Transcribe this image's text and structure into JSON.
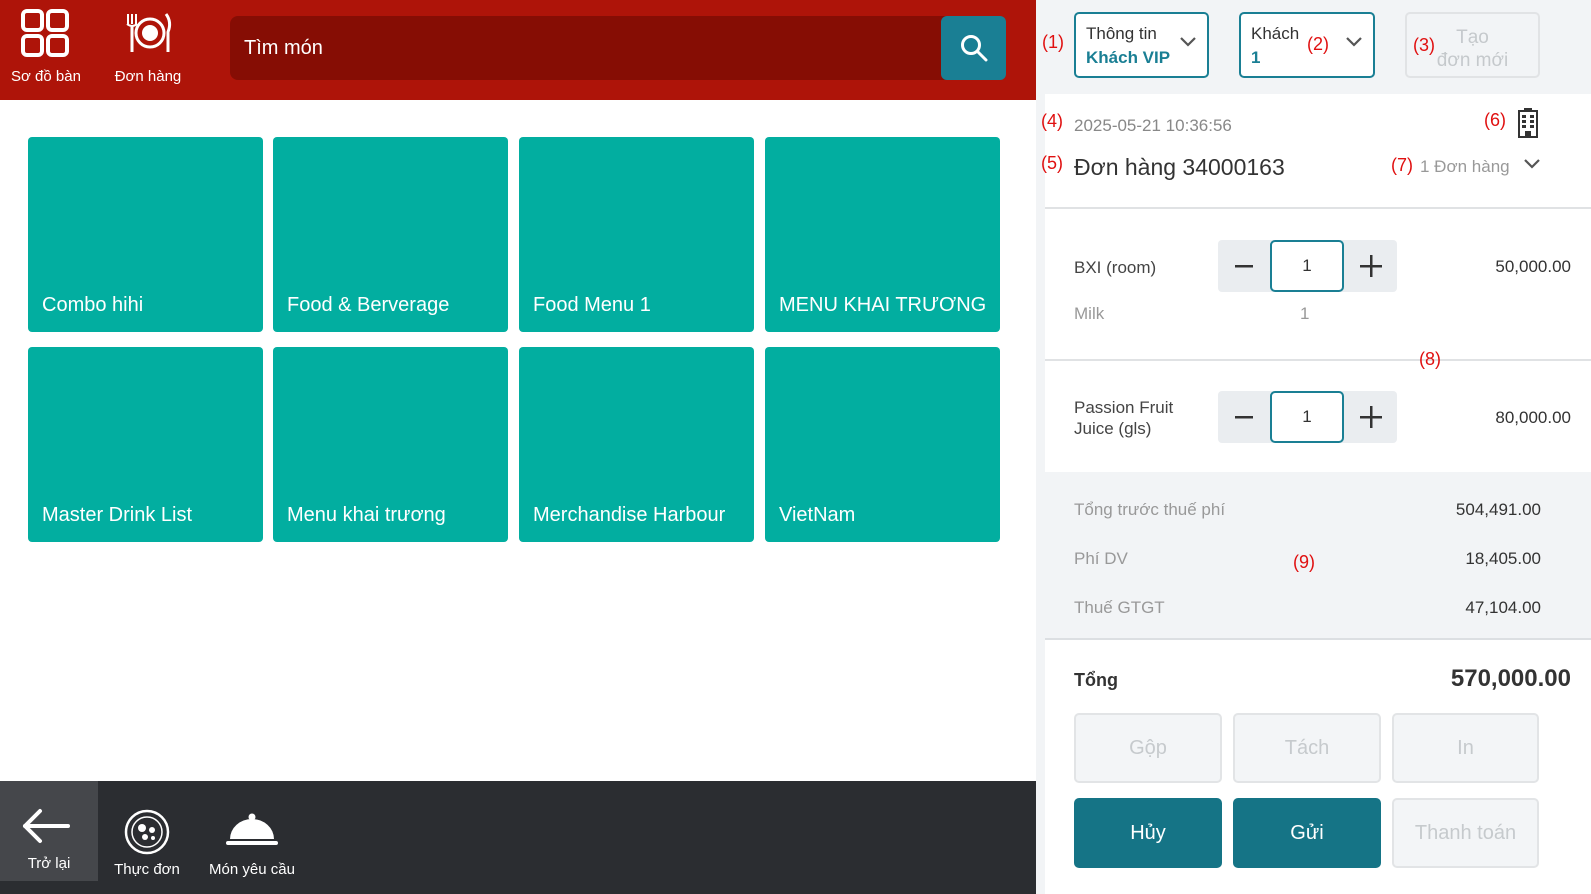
{
  "topbar": {
    "tables_label": "Sơ đồ bàn",
    "orders_label": "Đơn hàng",
    "search_placeholder": "Tìm món"
  },
  "menu_categories": [
    "Combo hihi",
    "Food & Berverage",
    "Food Menu 1",
    "MENU KHAI TRƯƠNG",
    "Master Drink List",
    "Menu khai trương",
    "Merchandise Harbour",
    "VietNam"
  ],
  "bottombar": {
    "back_label": "Trở lại",
    "menu_label": "Thực đơn",
    "request_label": "Món yêu cầu"
  },
  "order_panel": {
    "guest_label": "Thông tin",
    "guest_value": "Khách VIP",
    "people_label": "Khách",
    "people_value": "1",
    "new_order_line1": "Tạo",
    "new_order_line2": "đơn mới",
    "timestamp": "2025-05-21 10:36:56",
    "order_title": "Đơn hàng 34000163",
    "order_count": "1 Đơn hàng",
    "annotations": [
      "(1)",
      "(2)",
      "(3)",
      "(4)",
      "(5)",
      "(6)",
      "(7)",
      "(8)",
      "(9)"
    ],
    "items": [
      {
        "name": "BXI (room)",
        "qty": "1",
        "price": "50,000.00",
        "modifier": {
          "name": "Milk",
          "qty": "1"
        }
      },
      {
        "name_line1": "Passion Fruit",
        "name_line2": "Juice (gls)",
        "qty": "1",
        "price": "80,000.00"
      }
    ],
    "summary": {
      "subtotal_label": "Tổng trước thuế phí",
      "subtotal_value": "504,491.00",
      "service_label": "Phí DV",
      "service_value": "18,405.00",
      "vat_label": "Thuế GTGT",
      "vat_value": "47,104.00",
      "total_label": "Tổng",
      "total_value": "570,000.00"
    },
    "actions": {
      "merge": "Gộp",
      "split": "Tách",
      "print": "In",
      "cancel": "Hủy",
      "send": "Gửi",
      "pay": "Thanh toán"
    }
  },
  "colors": {
    "topbar": "#ae1409",
    "search_bg": "#860d04",
    "teal_tile": "#02aea0",
    "primary": "#1a7f94",
    "annotation": "#e01010"
  }
}
